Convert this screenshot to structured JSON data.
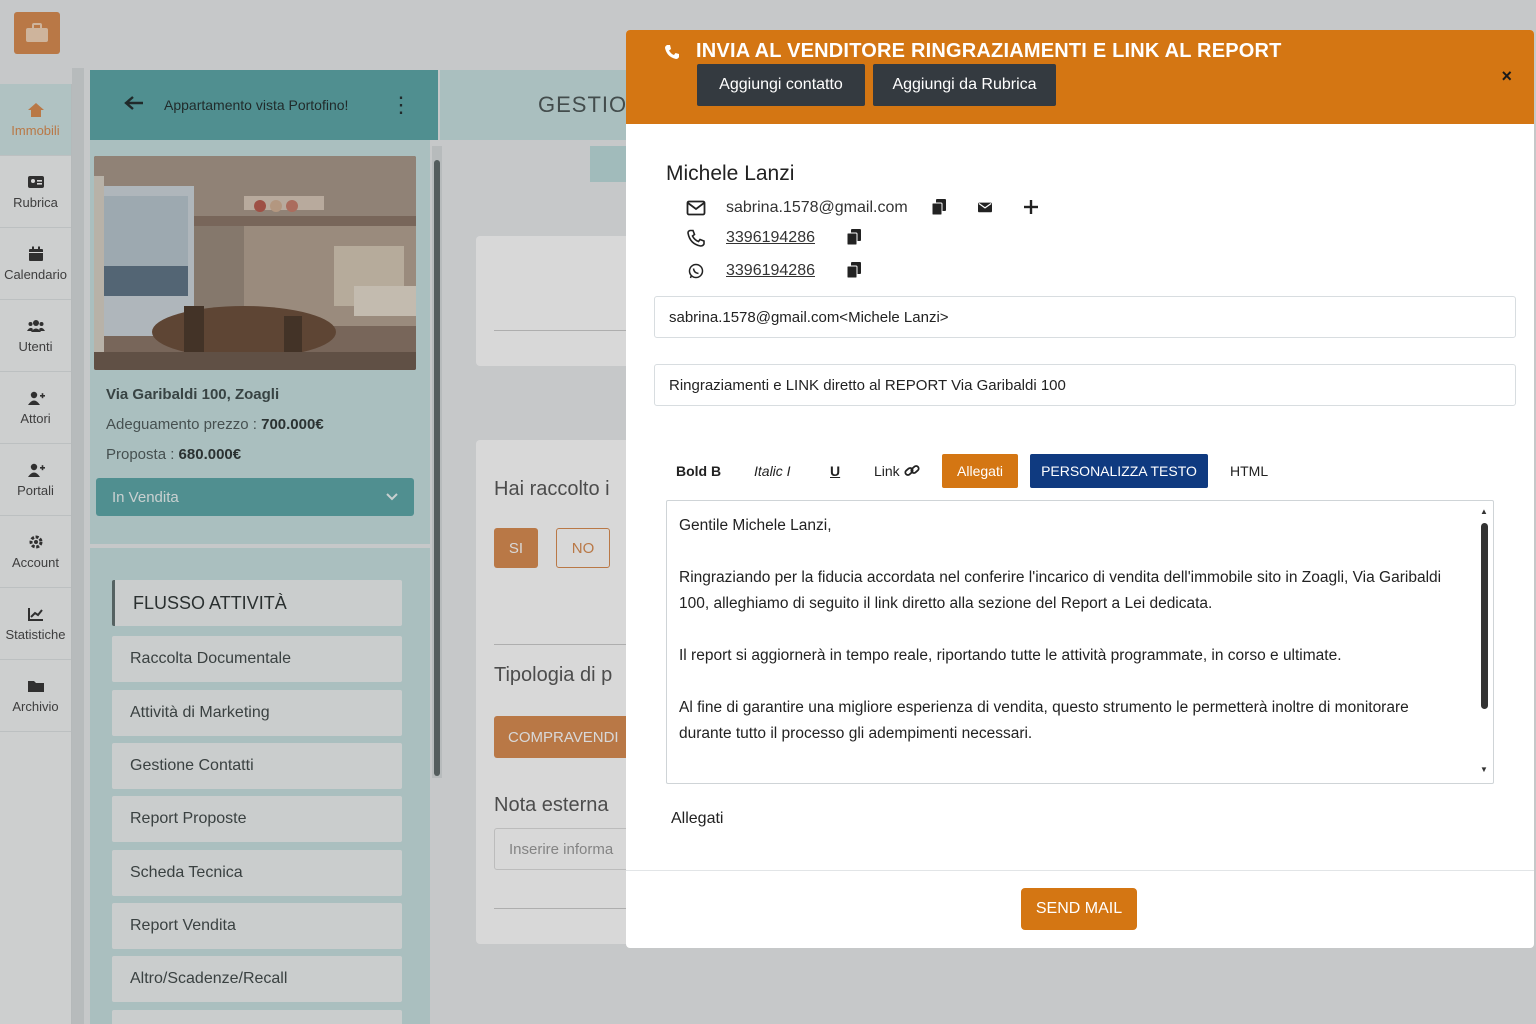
{
  "sidebar": {
    "items": [
      {
        "label": "Immobili",
        "icon": "home-icon",
        "active": true
      },
      {
        "label": "Rubrica",
        "icon": "address-card-icon"
      },
      {
        "label": "Calendario",
        "icon": "calendar-icon"
      },
      {
        "label": "Utenti",
        "icon": "users-icon"
      },
      {
        "label": "Attori",
        "icon": "user-plus-icon"
      },
      {
        "label": "Portali",
        "icon": "user-plus-icon"
      },
      {
        "label": "Account",
        "icon": "gear-icon"
      },
      {
        "label": "Statistiche",
        "icon": "chart-icon"
      },
      {
        "label": "Archivio",
        "icon": "folder-icon"
      }
    ]
  },
  "property": {
    "title": "Appartamento vista Portofino!",
    "address": "Via Garibaldi 100, Zoagli",
    "price_label": "Adeguamento prezzo : ",
    "price_value": "700.000€",
    "offer_label": "Proposta : ",
    "offer_value": "680.000€",
    "status": "In Vendita"
  },
  "flow": {
    "header": "FLUSSO ATTIVITÀ",
    "items": [
      "Raccolta Documentale",
      "Attività di Marketing",
      "Gestione Contatti",
      "Report Proposte",
      "Scheda Tecnica",
      "Report Vendita",
      "Altro/Scadenze/Recall"
    ]
  },
  "middle": {
    "header": "GESTIO",
    "question": "Hai raccolto i",
    "yes": "SI",
    "no": "NO",
    "tipologia": "Tipologia di p",
    "compravendita": "COMPRAVENDI",
    "nota": "Nota esterna",
    "nota_placeholder": "Inserire informa"
  },
  "modal": {
    "title": "INVIA AL VENDITORE RINGRAZIAMENTI E LINK AL REPORT",
    "add_contact": "Aggiungi contatto",
    "add_from_book": "Aggiungi da Rubrica",
    "close": "×",
    "contact": {
      "name": "Michele Lanzi",
      "email": "sabrina.1578@gmail.com",
      "phone": "3396194286",
      "whatsapp": "3396194286"
    },
    "to_field": "sabrina.1578@gmail.com<Michele Lanzi>",
    "subject": "Ringraziamenti e LINK diretto al REPORT Via Garibaldi 100",
    "toolbar": {
      "bold": "Bold B",
      "italic": "Italic I",
      "underline": "U",
      "link": "Link",
      "attachments": "Allegati",
      "personalize": "PERSONALIZZA TESTO",
      "html": "HTML"
    },
    "body": [
      "Gentile Michele Lanzi,",
      "Ringraziando per la fiducia accordata nel conferire l'incarico di vendita dell'immobile sito in Zoagli, Via Garibaldi 100, alleghiamo di seguito il link diretto alla sezione del Report a Lei dedicata.",
      "Il report si aggiornerà in tempo reale, riportando tutte le attività programmate, in corso e ultimate.",
      "Al fine di garantire una migliore esperienza di vendita, questo strumento le permetterà inoltre di monitorare durante tutto il processo  gli adempimenti necessari."
    ],
    "attachments_label": "Allegati",
    "send": "SEND MAIL"
  },
  "colors": {
    "teal": "#5aa7a8",
    "light_teal": "#c7e1e1",
    "orange": "#d47613",
    "dark_button": "#343a40",
    "navy": "#0f3a80"
  }
}
